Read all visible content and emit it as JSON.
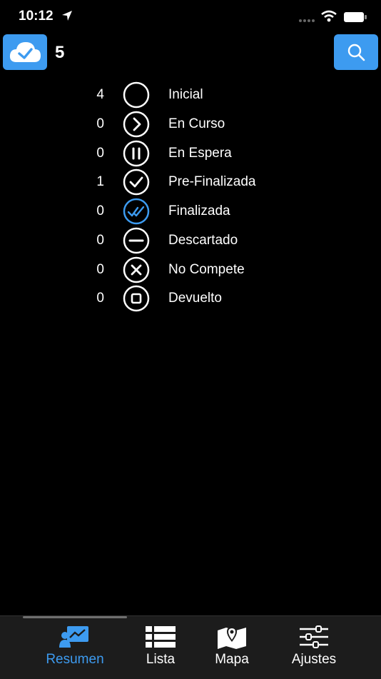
{
  "status_bar": {
    "time": "10:12"
  },
  "header": {
    "sync_icon": "cloud-check-icon",
    "pending_count": "5",
    "search_icon": "search-icon"
  },
  "colors": {
    "accent": "#3d9bf0",
    "background": "#000000",
    "tabbar": "#1c1c1c"
  },
  "statuses": [
    {
      "count": "4",
      "label": "Inicial",
      "icon": "empty-circle-icon"
    },
    {
      "count": "0",
      "label": "En Curso",
      "icon": "chevron-right-circle-icon"
    },
    {
      "count": "0",
      "label": "En Espera",
      "icon": "pause-circle-icon"
    },
    {
      "count": "1",
      "label": "Pre-Finalizada",
      "icon": "check-circle-icon"
    },
    {
      "count": "0",
      "label": "Finalizada",
      "icon": "double-check-circle-icon"
    },
    {
      "count": "0",
      "label": "Descartado",
      "icon": "minus-circle-icon"
    },
    {
      "count": "0",
      "label": "No Compete",
      "icon": "x-circle-icon"
    },
    {
      "count": "0",
      "label": "Devuelto",
      "icon": "square-circle-icon"
    }
  ],
  "tabs": [
    {
      "label": "Resumen",
      "icon": "chart-screen-icon",
      "active": true
    },
    {
      "label": "Lista",
      "icon": "list-icon",
      "active": false
    },
    {
      "label": "Mapa",
      "icon": "map-pin-icon",
      "active": false
    },
    {
      "label": "Ajustes",
      "icon": "sliders-icon",
      "active": false
    }
  ]
}
